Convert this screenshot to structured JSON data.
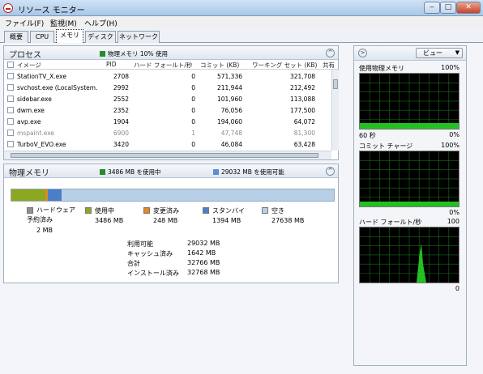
{
  "window": {
    "title": "リソース モニター",
    "min": "‒",
    "max": "□",
    "close": "✕"
  },
  "menu": [
    "ファイル(F)",
    "監視(M)",
    "ヘルプ(H)"
  ],
  "tabs": [
    "概要",
    "CPU",
    "メモリ",
    "ディスク",
    "ネットワーク"
  ],
  "active_tab": "メモリ",
  "process_panel": {
    "title": "プロセス",
    "summary": "物理メモリ 10% 使用",
    "summary_color": "#2a8a2a",
    "columns": [
      "イメージ",
      "PID",
      "ハード フォールト/秒",
      "コミット (KB)",
      "ワーキング セット (KB)",
      "共有"
    ],
    "rows": [
      [
        "StationTV_X.exe",
        "2708",
        "0",
        "571,336",
        "321,708"
      ],
      [
        "svchost.exe (LocalSystem...",
        "2992",
        "0",
        "211,944",
        "212,492"
      ],
      [
        "sidebar.exe",
        "2552",
        "0",
        "101,960",
        "113,088"
      ],
      [
        "dwm.exe",
        "2352",
        "0",
        "76,056",
        "177,500"
      ],
      [
        "avp.exe",
        "1904",
        "0",
        "194,060",
        "64,072"
      ],
      [
        "mspaint.exe",
        "6900",
        "1",
        "47,748",
        "81,300"
      ],
      [
        "TurboV_EVO.exe",
        "3420",
        "0",
        "46,084",
        "63,428"
      ]
    ],
    "dim_rows": [
      5
    ]
  },
  "memory_panel": {
    "title": "物理メモリ",
    "in_use": "3486 MB を使用中",
    "available": "29032 MB を使用可能",
    "in_use_color": "#2a8a2a",
    "available_color": "#5a8fd0",
    "bar": {
      "hardware_fraction": 0.0001,
      "inuse_fraction": 0.1064,
      "modified_fraction": 0.0076,
      "standby_fraction": 0.0425,
      "free_fraction": 0.8435
    },
    "legend": [
      {
        "label": "ハードウェア予約済み",
        "value": "2 MB",
        "color": "#909090"
      },
      {
        "label": "使用中",
        "value": "3486 MB",
        "color": "#8aa820"
      },
      {
        "label": "変更済み",
        "value": "248 MB",
        "color": "#e08a20"
      },
      {
        "label": "スタンバイ",
        "value": "1394 MB",
        "color": "#4a7fc8"
      },
      {
        "label": "空き",
        "value": "27638 MB",
        "color": "#b8cfe8"
      }
    ],
    "stats": [
      {
        "label": "利用可能",
        "value": "29032 MB"
      },
      {
        "label": "キャッシュ済み",
        "value": "1642 MB"
      },
      {
        "label": "合計",
        "value": "32766 MB"
      },
      {
        "label": "インストール済み",
        "value": "32768 MB"
      }
    ]
  },
  "side": {
    "view_button": "ビュー",
    "graphs": [
      {
        "title": "使用物理メモリ",
        "max": "100%",
        "foot_left": "60 秒",
        "foot_right": "0%"
      },
      {
        "title": "コミット チャージ",
        "max": "100%",
        "foot_left": "",
        "foot_right": "0%"
      },
      {
        "title": "ハード フォールト/秒",
        "max": "100",
        "foot_left": "",
        "foot_right": "0"
      }
    ]
  }
}
